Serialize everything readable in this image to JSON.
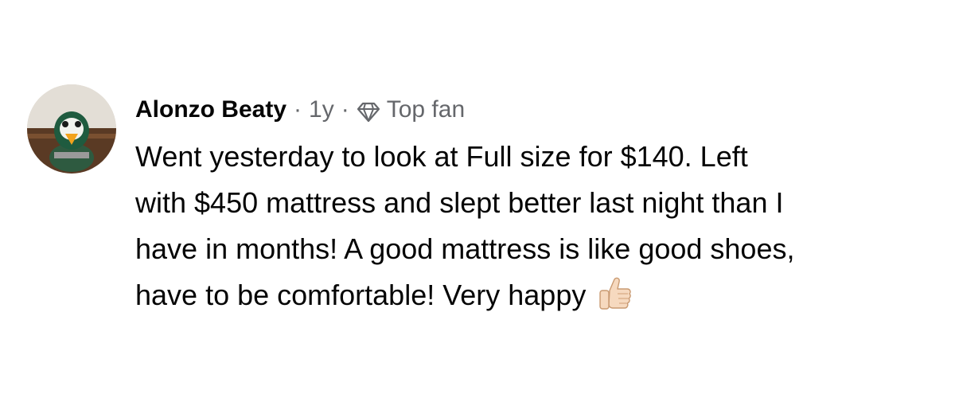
{
  "comment": {
    "author": "Alonzo Beaty",
    "separator": "·",
    "timestamp": "1y",
    "badge_icon": "diamond-icon",
    "badge_label": "Top fan",
    "text_lines": [
      "Went yesterday to look at Full size for $140. Left",
      "with $450 mattress and slept better last night than I",
      "have in months! A good mattress is like good shoes,",
      "have to be comfortable! Very happy"
    ],
    "emoji": "thumbs-up-icon"
  },
  "colors": {
    "text": "#050505",
    "secondary": "#65676b",
    "background": "#ffffff"
  }
}
